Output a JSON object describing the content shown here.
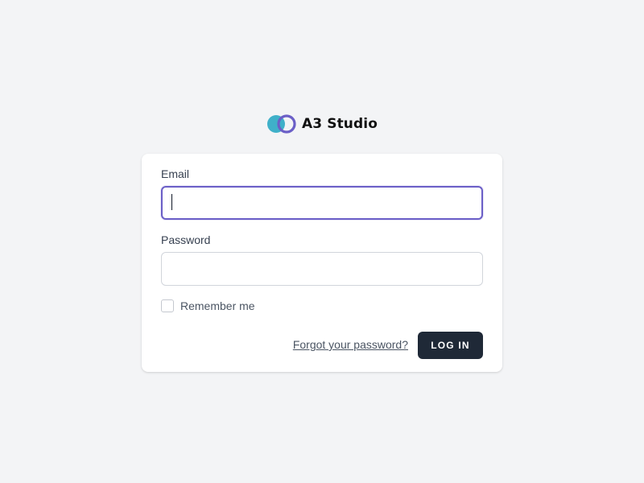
{
  "brand": {
    "name": "A3 Studio",
    "logo_icon": "overlapping-circles-logo",
    "colors": {
      "teal": "#3fb0c9",
      "purple": "#6b5fc7"
    }
  },
  "form": {
    "email_label": "Email",
    "email_value": "",
    "password_label": "Password",
    "password_value": "",
    "remember_label": "Remember me",
    "remember_checked": false,
    "forgot_link": "Forgot your password?",
    "login_button": "LOG IN"
  },
  "colors": {
    "background": "#f3f4f6",
    "card": "#ffffff",
    "focus_ring": "#6b5fc7",
    "button": "#1f2937"
  }
}
